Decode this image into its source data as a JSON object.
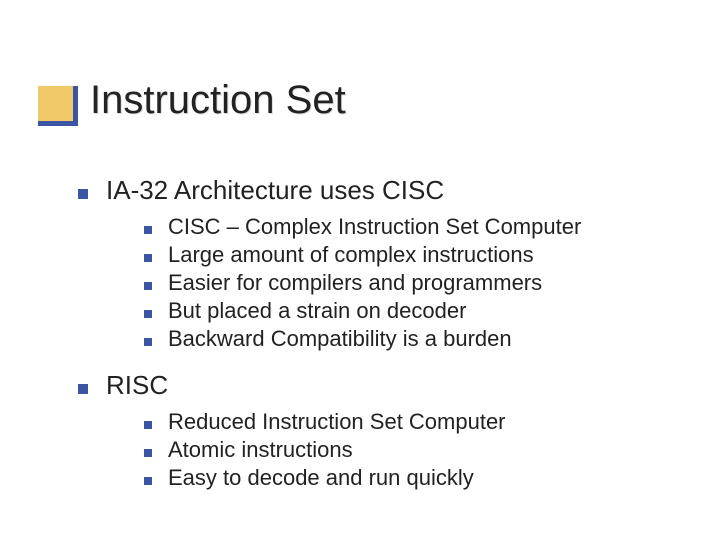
{
  "title": "Instruction Set",
  "sections": [
    {
      "heading": "IA-32 Architecture uses CISC",
      "items": [
        "CISC – Complex Instruction Set Computer",
        "Large amount of complex instructions",
        "Easier for compilers and programmers",
        "But placed a strain on decoder",
        "Backward Compatibility is a burden"
      ]
    },
    {
      "heading": "RISC",
      "items": [
        "Reduced Instruction Set Computer",
        "Atomic instructions",
        "Easy to decode and run quickly"
      ]
    }
  ],
  "colors": {
    "bullet": "#3955a4",
    "accent_fill": "#f2c968"
  }
}
